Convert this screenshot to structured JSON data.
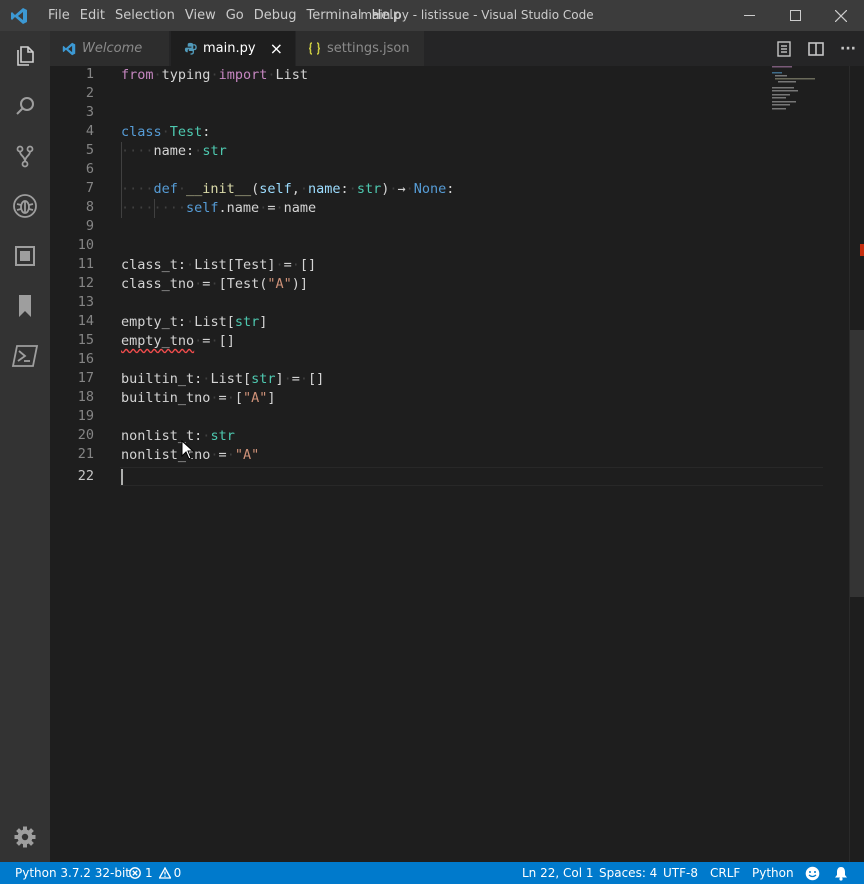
{
  "titlebar": {
    "menu": [
      "File",
      "Edit",
      "Selection",
      "View",
      "Go",
      "Debug",
      "Terminal",
      "Help"
    ],
    "title": "main.py - listissue - Visual Studio Code"
  },
  "activity": [
    "files-icon",
    "search-icon",
    "source-control-icon",
    "debug-icon",
    "extensions-icon",
    "bookmark-icon",
    "terminal-icon",
    "settings-gear-icon"
  ],
  "tabs": [
    {
      "label": "Welcome",
      "icon": "vscode-icon",
      "active": false,
      "italic": true
    },
    {
      "label": "main.py",
      "icon": "python-icon",
      "active": true,
      "italic": false
    },
    {
      "label": "settings.json",
      "icon": "json-icon",
      "active": false,
      "italic": false
    }
  ],
  "tab_close_glyph": "×",
  "tab_more_glyph": "···",
  "editor": {
    "line_numbers": [
      "1",
      "2",
      "3",
      "4",
      "5",
      "6",
      "7",
      "8",
      "9",
      "10",
      "11",
      "12",
      "13",
      "14",
      "15",
      "16",
      "17",
      "18",
      "19",
      "20",
      "21",
      "22"
    ],
    "active_line": "22",
    "text": {
      "from": "from",
      "typing": "typing",
      "import": "import",
      "List": "List",
      "class": "class",
      "Test": "Test",
      "colon": ":",
      "name": "name",
      "str": "str",
      "def": "def",
      "init": "__init__",
      "self": "self",
      "arrow": "→",
      "None": "None",
      "dotname": ".name",
      "eq": "=",
      "class_t": "class_t",
      "class_tno": "class_tno",
      "Test_call_open": "[Test(",
      "A_str": "\"A\"",
      "close_pb": ")]",
      "empty_t": "empty_t",
      "empty_tno": "empty_tno",
      "empty_list": "[]",
      "builtin_t": "builtin_t",
      "builtin_tno": "builtin_tno",
      "list_A": "[\"A\"]",
      "nonlist_t": "nonlist_t",
      "nonlist_tno": "nonlist_tno"
    }
  },
  "statusbar": {
    "interpreter": "Python 3.7.2 32-bit",
    "errors": "1",
    "warnings": "0",
    "position": "Ln 22, Col 1",
    "spaces": "Spaces: 4",
    "encoding": "UTF-8",
    "eol": "CRLF",
    "language": "Python"
  },
  "colors": {
    "accent": "#007acc",
    "keyword": "#c586c0",
    "class_name": "#4ec9b0",
    "string": "#ce9178",
    "storage": "#569cd6"
  }
}
